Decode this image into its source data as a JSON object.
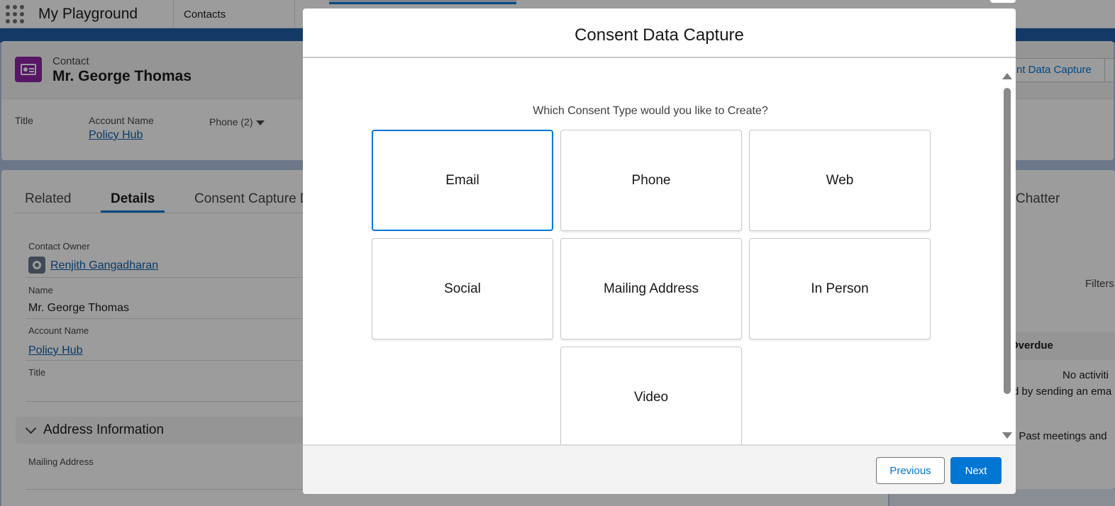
{
  "app": {
    "name": "My Playground",
    "nav_tab": "Contacts"
  },
  "record": {
    "object_label": "Contact",
    "name": "Mr. George Thomas",
    "header_fields": {
      "title_label": "Title",
      "account_label": "Account Name",
      "account_value": "Policy Hub",
      "phone_label": "Phone (2)"
    },
    "header_action": "nt Data Capture"
  },
  "tabs": [
    "Related",
    "Details",
    "Consent Capture D"
  ],
  "details": {
    "owner_label": "Contact Owner",
    "owner_value": "Renjith Gangadharan",
    "name_label": "Name",
    "name_value": "Mr. George Thomas",
    "account_label": "Account Name",
    "account_value": "Policy Hub",
    "title_label": "Title",
    "section_title": "Address Information",
    "mailing_label": "Mailing Address"
  },
  "side": {
    "tab": "Chatter",
    "filters": "Filters",
    "overdue": "Overdue",
    "line1": "No activiti",
    "line2": "d by sending an ema",
    "line3": ". Past meetings and"
  },
  "modal": {
    "title": "Consent Data Capture",
    "question": "Which Consent Type would you like to Create?",
    "options": [
      "Email",
      "Phone",
      "Web",
      "Social",
      "Mailing Address",
      "In Person",
      "Video"
    ],
    "selected": "Email",
    "previous_label": "Previous",
    "next_label": "Next"
  },
  "colors": {
    "brand": "#0176d3",
    "contact_icon": "#8b21a3",
    "link": "#0b5cab"
  }
}
